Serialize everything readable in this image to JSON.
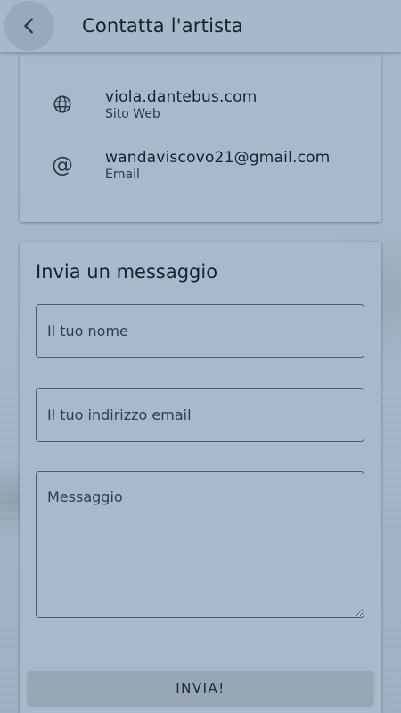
{
  "appbar": {
    "title": "Contatta l'artista",
    "back_icon": "chevron-left-icon"
  },
  "contact": {
    "items": [
      {
        "icon": "globe-icon",
        "value": "viola.dantebus.com",
        "label": "Sito Web"
      },
      {
        "icon": "at-icon",
        "value": "wandaviscovo21@gmail.com",
        "label": "Email"
      }
    ]
  },
  "message_form": {
    "title": "Invia un messaggio",
    "name_placeholder": "Il tuo nome",
    "email_placeholder": "Il tuo indirizzo email",
    "message_placeholder": "Messaggio",
    "send_label": "INVIA!"
  },
  "colors": {
    "background": "#a9b9cb",
    "card": "#a8b9cb",
    "button": "#97a7b5",
    "text": "#16212c"
  }
}
